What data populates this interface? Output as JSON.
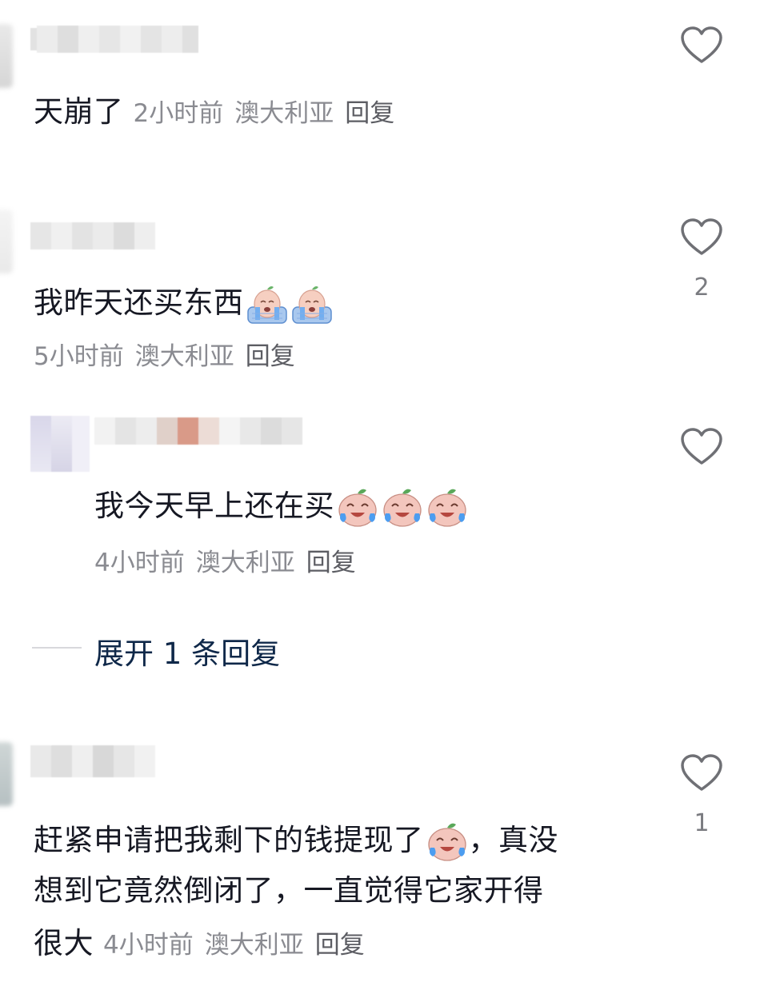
{
  "comments": [
    {
      "text": "天崩了",
      "time": "2小时前",
      "location": "澳大利亚",
      "reply_label": "回复",
      "likes": "",
      "emoji_icons": []
    },
    {
      "text": "我昨天还买东西",
      "time": "5小时前",
      "location": "澳大利亚",
      "reply_label": "回复",
      "likes": "2",
      "emoji_icons": [
        "crying-sticker-icon",
        "crying-sticker-icon"
      ]
    },
    {
      "text": "我今天早上还在买",
      "time": "4小时前",
      "location": "澳大利亚",
      "reply_label": "回复",
      "likes": "",
      "emoji_icons": [
        "laugh-cry-sticker-icon",
        "laugh-cry-sticker-icon",
        "laugh-cry-sticker-icon"
      ]
    },
    {
      "text_line1": "赶紧申请把我剩下的钱提现了",
      "text_line1_end": "，真没",
      "text_line2": "想到它竟然倒闭了，一直觉得它家开得",
      "text_line3": "很大",
      "time": "4小时前",
      "location": "澳大利亚",
      "reply_label": "回复",
      "likes": "1",
      "emoji_icons": [
        "laugh-cry-sticker-icon"
      ]
    }
  ],
  "expand_replies_label": "展开 1 条回复",
  "colors": {
    "text": "#161823",
    "meta": "#8a8b91",
    "expand": "#0f2849",
    "heart_outline": "#6f7075"
  }
}
